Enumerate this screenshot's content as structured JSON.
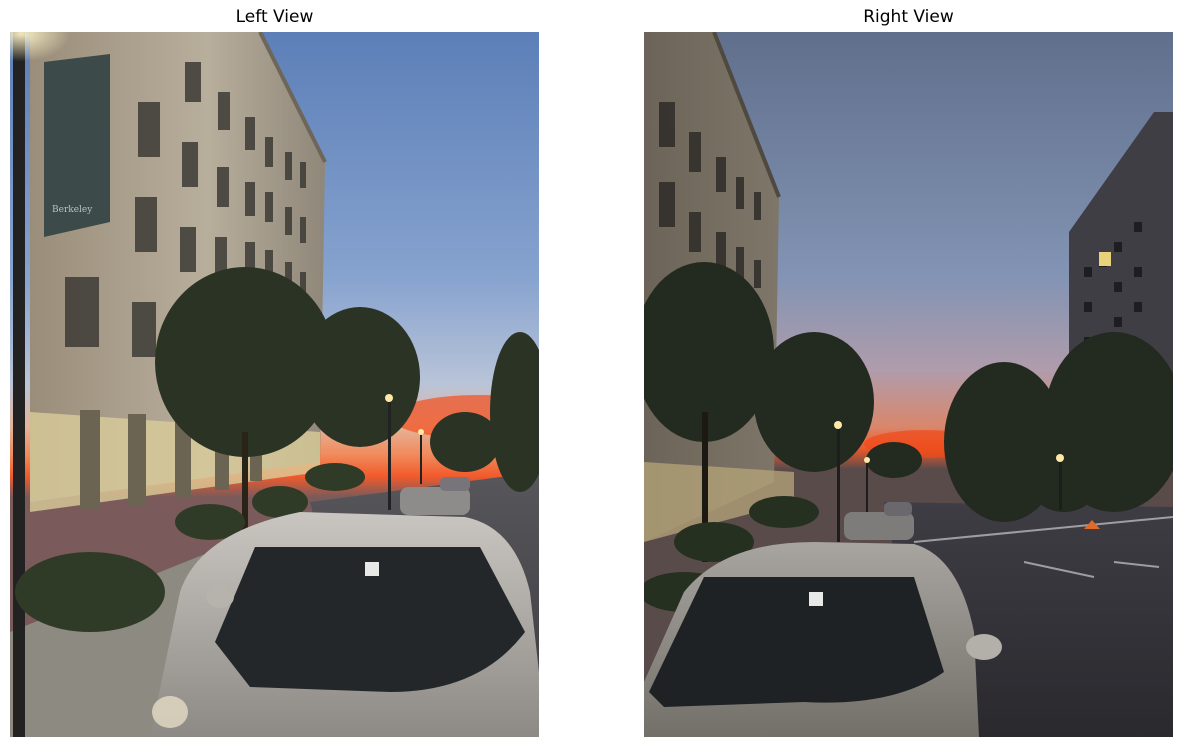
{
  "panels": [
    {
      "title": "Left View"
    },
    {
      "title": "Right View"
    }
  ],
  "banner_text": "Berkeley"
}
